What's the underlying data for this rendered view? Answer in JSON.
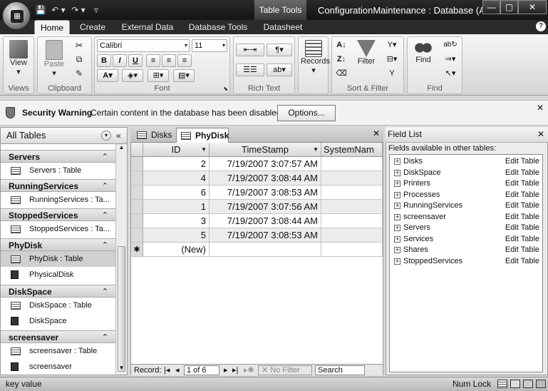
{
  "app": {
    "window_title": "ConfigurationMaintenance : Database (A...",
    "context_tab": "Table Tools"
  },
  "qat": {
    "save": "💾",
    "undo": "↶ ▾",
    "redo": "↷ ▾",
    "customize": "▿"
  },
  "window_controls": {
    "min": "—",
    "max": "▢",
    "close": "✕"
  },
  "ribbon_tabs": [
    "Home",
    "Create",
    "External Data",
    "Database Tools",
    "Datasheet"
  ],
  "ribbon": {
    "views": {
      "label": "Views",
      "view_btn": "View"
    },
    "clipboard": {
      "label": "Clipboard",
      "paste": "Paste"
    },
    "font": {
      "label": "Font",
      "font_name": "Calibri",
      "font_size": "11",
      "bold": "B",
      "italic": "I",
      "underline": "U"
    },
    "rich_text": {
      "label": "Rich Text"
    },
    "records": {
      "label": "Records"
    },
    "sort_filter": {
      "label": "Sort & Filter",
      "filter": "Filter"
    },
    "find": {
      "label": "Find",
      "find_btn": "Find"
    }
  },
  "security": {
    "title": "Security Warning",
    "message": "Certain content in the database has been disabled",
    "options_btn": "Options..."
  },
  "nav_pane": {
    "header": "All Tables",
    "groups": [
      {
        "name": "Servers",
        "items": [
          {
            "label": "Servers : Table",
            "type": "table"
          }
        ]
      },
      {
        "name": "RunningServices",
        "items": [
          {
            "label": "RunningServices : Ta...",
            "type": "table"
          }
        ]
      },
      {
        "name": "StoppedServices",
        "items": [
          {
            "label": "StoppedServices : Ta...",
            "type": "table"
          }
        ]
      },
      {
        "name": "PhyDisk",
        "items": [
          {
            "label": "PhyDisk : Table",
            "type": "table",
            "selected": true
          },
          {
            "label": "PhysicalDisk",
            "type": "query"
          }
        ]
      },
      {
        "name": "DiskSpace",
        "items": [
          {
            "label": "DiskSpace : Table",
            "type": "table"
          },
          {
            "label": "DiskSpace",
            "type": "query"
          }
        ]
      },
      {
        "name": "screensaver",
        "items": [
          {
            "label": "screensaver : Table",
            "type": "table"
          },
          {
            "label": "screensaver",
            "type": "query"
          }
        ]
      }
    ]
  },
  "document": {
    "tabs": [
      {
        "label": "Disks"
      },
      {
        "label": "PhyDisk",
        "active": true
      }
    ],
    "columns": [
      "ID",
      "TimeStamp",
      "SystemNam"
    ],
    "rows": [
      {
        "id": "2",
        "timestamp": "7/19/2007 3:07:57 AM",
        "system": ""
      },
      {
        "id": "4",
        "timestamp": "7/19/2007 3:08:44 AM",
        "system": ""
      },
      {
        "id": "6",
        "timestamp": "7/19/2007 3:08:53 AM",
        "system": ""
      },
      {
        "id": "1",
        "timestamp": "7/19/2007 3:07:56 AM",
        "system": ""
      },
      {
        "id": "3",
        "timestamp": "7/19/2007 3:08:44 AM",
        "system": ""
      },
      {
        "id": "5",
        "timestamp": "7/19/2007 3:08:53 AM",
        "system": ""
      }
    ],
    "new_row": "(New)",
    "new_marker": "✱",
    "record_nav": {
      "label": "Record:",
      "position": "1 of 6",
      "filter": "No Filter",
      "search": "Search"
    }
  },
  "field_list": {
    "title": "Field List",
    "subtitle": "Fields available in other tables:",
    "tables": [
      "Disks",
      "DiskSpace",
      "Printers",
      "Processes",
      "RunningServices",
      "screensaver",
      "Servers",
      "Services",
      "Shares",
      "StoppedServices"
    ],
    "edit_label": "Edit Table"
  },
  "status_bar": {
    "left": "key value",
    "numlock": "Num Lock"
  }
}
